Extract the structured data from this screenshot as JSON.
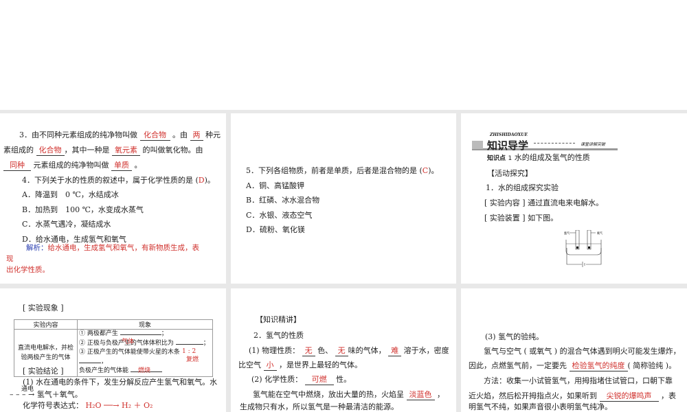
{
  "p1": {
    "q3a": "3．由不同种元素组成的纯净物叫做",
    "a1": "化合物",
    "q3b": "。由",
    "a2": "两",
    "q3c": "种元",
    "q3d": "素组成的",
    "a3": "化合物",
    "q3e": "，其中一种是",
    "a4": "氧元素",
    "q3f": "的叫做氧化物。由",
    "a5": "同种",
    "q3g": "元素组成的纯净物叫做",
    "a6": "单质",
    "q3h": "。",
    "q4": "4．下列关于水的性质的叙述中，属于化学性质的是 (",
    "q4ans": "D",
    "q4end": ")。",
    "opts": [
      "A．降温到　0 ℃，水结成冰",
      "B．加热到　100 ℃，水变成水蒸气",
      "C．水蒸气遇冷，凝结成水",
      "D．给水通电，生成氢气和氧气"
    ],
    "note_label": "解析：",
    "note1": "给水通电，生成氢气和氧气，有新物质生成，表",
    "note2": "现",
    "note3": "出化学性质。"
  },
  "p2": {
    "q5": "5．下列各组物质，前者是单质，后者是混合物的是 (",
    "ans": "C",
    "end": ")。",
    "opts": [
      "A．铜、高锰酸钾",
      "B．红磷、冰水混合物",
      "C．水银、液态空气",
      "D．硫粉、氧化镁"
    ]
  },
  "p3": {
    "banner_en": "ZHISHIDAOXUE",
    "banner": "知识导学",
    "banner_sub": "课堂讲解突破",
    "kp": "知识点",
    "kp_num": "1",
    "kp_title": "水的组成及氢气的性质",
    "act": "【活动探究】",
    "l1": "1．水的组成探究实验",
    "l2": "[ 实验内容 ] 通过直流电来电解水。",
    "l3": "[ 实验装置 ] 如下图。",
    "fig_l": "氢气",
    "fig_r": "氧气"
  },
  "p4": {
    "h": "[ 实验现象 ]",
    "th1": "实验内容",
    "th2": "现象",
    "c1": "直流电电解水，并检验两极产生的气体",
    "r1": "① 两极都产生",
    "a1": "气体",
    "r2": "② 正极与负极产生的气体体积比为",
    "a2": "1 : 2",
    "r3": "③ 正极产生的气体能使带火星的木条",
    "a3": "复燃",
    "r4": "负极产生的气体能",
    "a4": "燃烧",
    "concl": "[ 实验结论 ]",
    "c_1": "(1) 水在通电的条件下，发生分解反应产生氢气和氧气。水",
    "c_cond": "通电",
    "c_2": "氢气＋氧气。",
    "c_3": "化学符号表达式：",
    "eq": "H₂O ──→ H₂ ＋ O₂"
  },
  "p5": {
    "h": "【知识精讲】",
    "t": "2．氢气的性质",
    "l1a": "(1) 物理性质：",
    "a1": "无",
    "l1b": "色、",
    "a2": "无",
    "l1c": "味的气体，",
    "a3": "难",
    "l1d": "溶于水，密度",
    "l2a": "比空气",
    "a4": "小",
    "l2b": "，是世界上最轻的气体。",
    "l3a": "(2) 化学性质：",
    "a5": "可燃",
    "l3b": "性。",
    "l4a": "氢气能在空气中燃烧，放出大量的热，火焰呈",
    "a6": "淡蓝色",
    "l4b": "，",
    "l5": "生成物只有水，所以氢气是一种最清洁的能源。"
  },
  "p6": {
    "t": "(3) 氢气的验纯。",
    "l1": "氢气与空气 ( 或氧气 ) 的混合气体遇到明火可能发生爆炸，",
    "l2a": "因此，点燃氢气前，一定要先",
    "a1": "检验氢气的纯度",
    "l2b": "( 简称验纯 )。",
    "l3": "方法：收集一小试管氢气，用拇指堵住试管口，口朝下靠",
    "l4a": "近火焰，然后松开拇指点火，如果听到",
    "a2": "尖锐的爆鸣声",
    "l4b": "，表",
    "l5": "明氢气不纯，如果声音很小表明氢气纯净。"
  }
}
